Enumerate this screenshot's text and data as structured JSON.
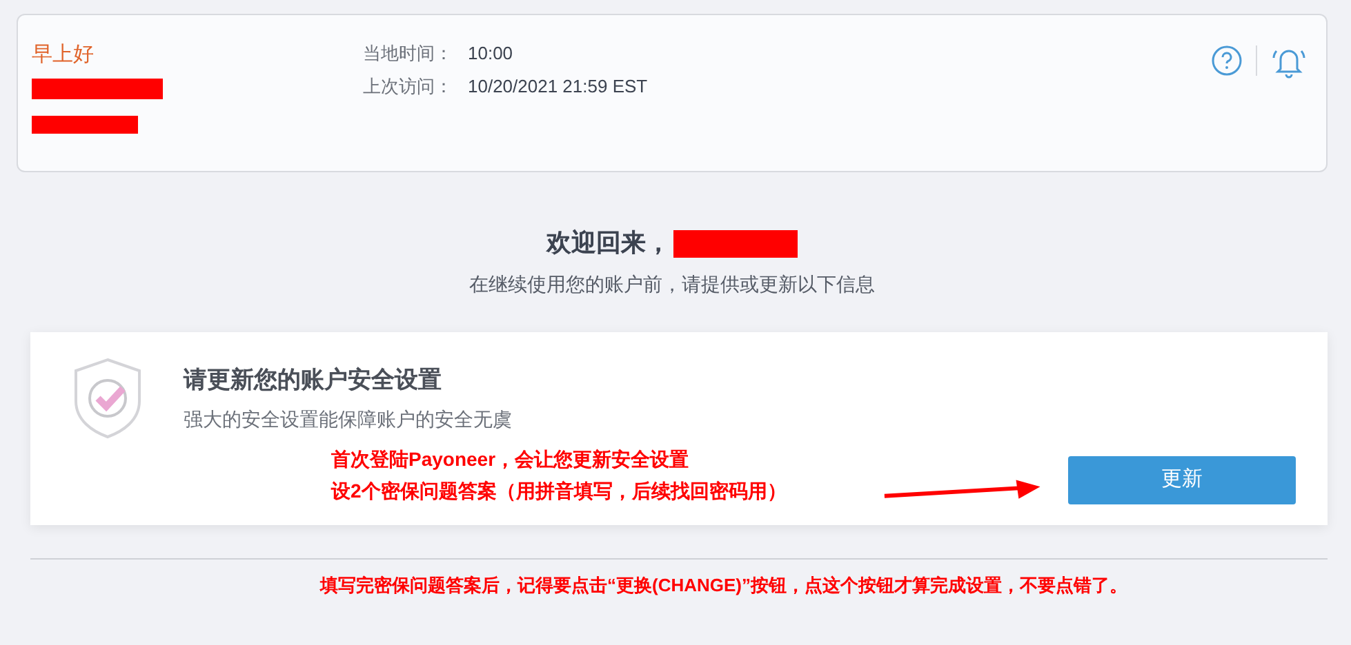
{
  "header": {
    "greeting": "早上好",
    "info": [
      {
        "label": "当地时间：",
        "value": "10:00"
      },
      {
        "label": "上次访问：",
        "value": "10/20/2021 21:59 EST"
      }
    ]
  },
  "welcome": {
    "title": "欢迎回来，",
    "subtitle": "在继续使用您的账户前，请提供或更新以下信息"
  },
  "security_card": {
    "title": "请更新您的账户安全设置",
    "description": "强大的安全设置能保障账户的安全无虞",
    "button": "更新"
  },
  "annotations": {
    "card_note": [
      "首次登陆Payoneer，会让您更新安全设置",
      "设2个密保问题答案（用拼音填写，后续找回密码用）"
    ],
    "bottom_note": "填写完密保问题答案后，记得要点击“更换(CHANGE)”按钮，点这个按钮才算完成设置，不要点错了。"
  }
}
